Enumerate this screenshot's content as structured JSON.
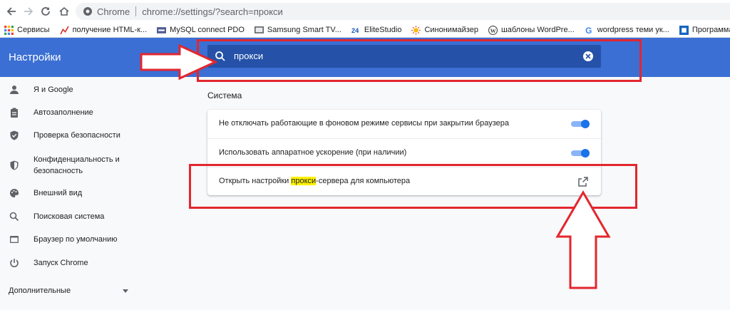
{
  "browser": {
    "site_label": "Chrome",
    "url": "chrome://settings/?search=прокси"
  },
  "bookmarks": [
    {
      "label": "Сервисы",
      "icon": "apps-grid-icon",
      "color": "#ea4335"
    },
    {
      "label": "получение HTML-к...",
      "icon": "chart-line-icon",
      "color": "#d93025"
    },
    {
      "label": "MySQL connect PDO",
      "icon": "php-icon",
      "color": "#4f5b93"
    },
    {
      "label": "Samsung Smart TV...",
      "icon": "tv-icon",
      "color": "#5f6368"
    },
    {
      "label": "EliteStudio",
      "icon": "number-24-icon",
      "color": "#1a56b5"
    },
    {
      "label": "Синонимайзер",
      "icon": "sun-icon",
      "color": "#fbbc04"
    },
    {
      "label": "шаблоны WordPre...",
      "icon": "wordpress-icon",
      "color": "#464342"
    },
    {
      "label": "wordpress теми ук...",
      "icon": "google-g-icon",
      "color": "#4285f4"
    },
    {
      "label": "Программа ArCon...",
      "icon": "blue-square-icon",
      "color": "#1565c0"
    }
  ],
  "header": {
    "title": "Настройки",
    "search_value": "прокси"
  },
  "sidebar": {
    "items": [
      {
        "label": "Я и Google",
        "icon": "person-icon"
      },
      {
        "label": "Автозаполнение",
        "icon": "clipboard-icon"
      },
      {
        "label": "Проверка безопасности",
        "icon": "shield-check-icon"
      },
      {
        "label": "Конфиденциальность и безопасность",
        "icon": "shield-icon"
      },
      {
        "label": "Внешний вид",
        "icon": "palette-icon"
      },
      {
        "label": "Поисковая система",
        "icon": "search-icon"
      },
      {
        "label": "Браузер по умолчанию",
        "icon": "browser-window-icon"
      },
      {
        "label": "Запуск Chrome",
        "icon": "power-icon"
      }
    ],
    "advanced_label": "Дополнительные"
  },
  "main": {
    "section_title": "Система",
    "rows": {
      "background_apps": {
        "label": "Не отключать работающие в фоновом режиме сервисы при закрытии браузера",
        "enabled": true
      },
      "hardware_accel": {
        "label": "Использовать аппаратное ускорение (при наличии)",
        "enabled": true
      },
      "proxy": {
        "label_before": "Открыть настройки ",
        "label_highlight": "прокси",
        "label_after": "-сервера для компьютера",
        "icon": "open-in-new-icon"
      }
    }
  },
  "colors": {
    "header_blue": "#3b6fd4",
    "search_blue": "#2552a8",
    "toggle_blue": "#1a73e8",
    "annotation_red": "#e3262e",
    "highlight_yellow": "#fff200"
  }
}
